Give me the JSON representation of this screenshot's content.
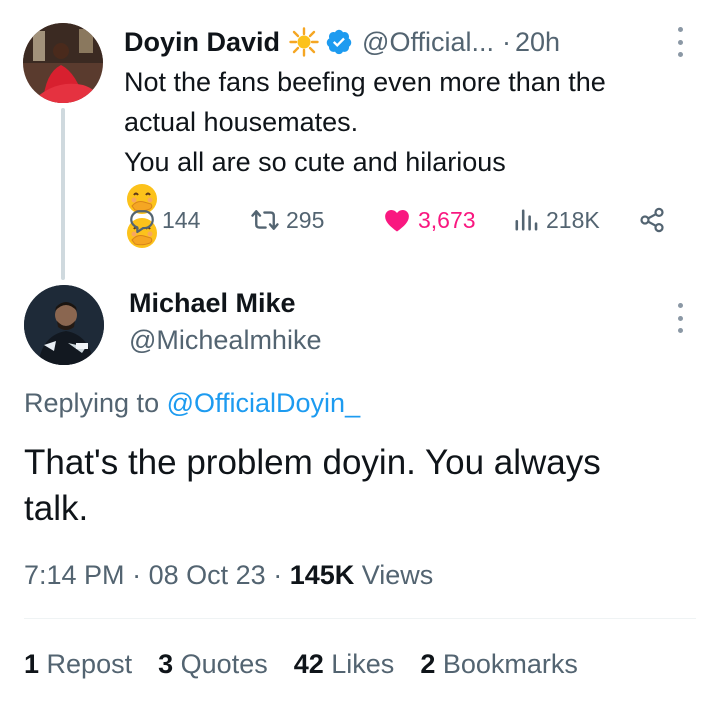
{
  "parent_tweet": {
    "author_name": "Doyin David",
    "handle": "@Official...",
    "separator": "·",
    "time": "20h",
    "text_lines": [
      "Not the fans beefing even more than the",
      "actual housemates.",
      "You all are so cute and hilarious"
    ],
    "emojis": [
      "face-with-hand-over-mouth",
      "face-with-hand-over-mouth"
    ],
    "actions": {
      "replies": "144",
      "reposts": "295",
      "likes": "3,673",
      "views": "218K"
    },
    "icons": {
      "badge": "sparkle-sun-icon",
      "verified": "verified-badge-icon",
      "more": "more-vertical-icon",
      "reply": "reply-icon",
      "repost": "repost-icon",
      "like": "heart-icon",
      "views": "views-chart-icon",
      "share": "share-icon"
    }
  },
  "reply_tweet": {
    "author_name": "Michael Mike",
    "handle": "@Michealmhike",
    "replying_prefix": "Replying to",
    "replying_to": "@OfficialDoyin_",
    "text": "That's the problem doyin. You always talk.",
    "timestamp": "7:14 PM",
    "separator": "·",
    "date": "08 Oct 23",
    "views_count": "145K",
    "views_label": "Views"
  },
  "engagement": [
    {
      "count": "1",
      "label": "Repost"
    },
    {
      "count": "3",
      "label": "Quotes"
    },
    {
      "count": "42",
      "label": "Likes"
    },
    {
      "count": "2",
      "label": "Bookmarks"
    }
  ],
  "colors": {
    "text": "#0f1419",
    "secondary": "#536471",
    "link": "#1d9bf0",
    "like": "#f91880",
    "verified": "#1d9bf0",
    "thread_line": "#cfd9de"
  }
}
